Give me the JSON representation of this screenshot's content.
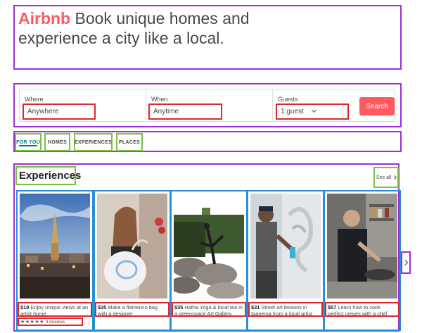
{
  "hero": {
    "brand": "Airbnb",
    "tagline": " Book unique homes and experience a city like a local."
  },
  "search": {
    "where_label": "Where",
    "where_value": "Anywhere",
    "when_label": "When",
    "when_value": "Anytime",
    "guests_label": "Guests",
    "guests_value": "1 guest",
    "button_label": "Search"
  },
  "tabs": [
    {
      "label": "FOR YOU",
      "active": true
    },
    {
      "label": "HOMES",
      "active": false
    },
    {
      "label": "EXPERIENCES",
      "active": false
    },
    {
      "label": "PLACES",
      "active": false
    }
  ],
  "experiences": {
    "title": "Experiences",
    "see_all": "See all",
    "cards": [
      {
        "price": "$19",
        "title": "Enjoy unique views at an artist home",
        "stars": "★★★★★",
        "reviews": "4 reviews"
      },
      {
        "price": "$35",
        "title": "Make a flamenco bag with a designer"
      },
      {
        "price": "$35",
        "title": "Hatha Yoga & local tea in a greenspace Art Gallery"
      },
      {
        "price": "$31",
        "title": "Street art lessons in Ipanema from a local artist"
      },
      {
        "price": "$57",
        "title": "Learn how to cook perfect crepes with a chef"
      }
    ]
  },
  "colors": {
    "brand": "#ff5a5f",
    "accent_teal": "#007a87",
    "annotation_purple": "#9b30d9",
    "annotation_green": "#7ac142",
    "annotation_red": "#e0262e",
    "annotation_blue": "#2a8fd6"
  },
  "icons": [
    "chevron-down-icon",
    "chevron-right-icon",
    "star-icon"
  ]
}
